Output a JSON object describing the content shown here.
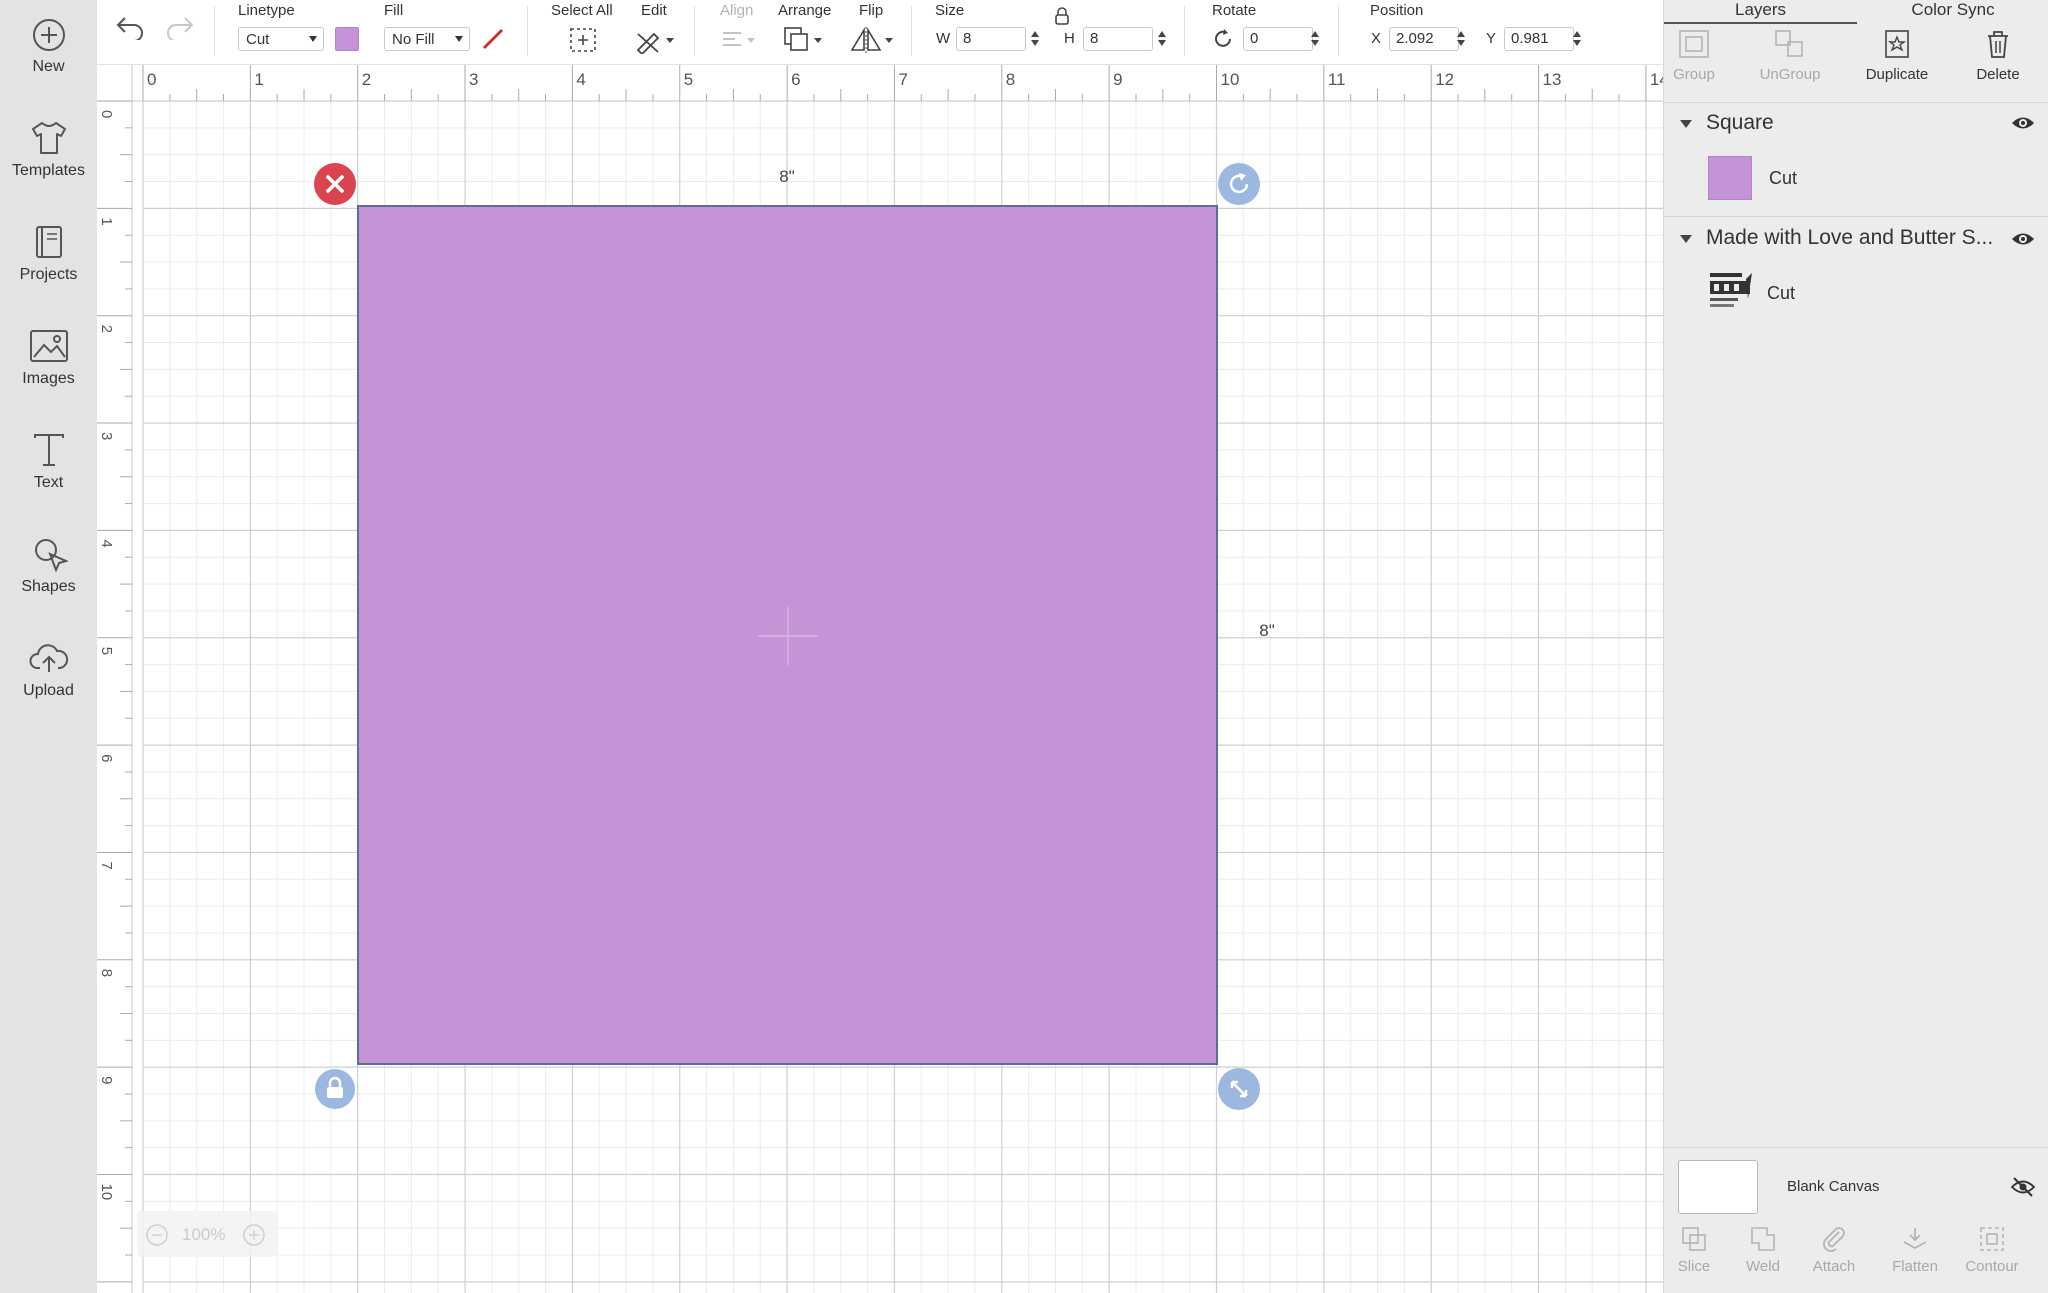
{
  "sidebar": {
    "items": [
      {
        "label": "New",
        "icon": "plus-circle-icon"
      },
      {
        "label": "Templates",
        "icon": "tshirt-icon"
      },
      {
        "label": "Projects",
        "icon": "book-icon"
      },
      {
        "label": "Images",
        "icon": "image-icon"
      },
      {
        "label": "Text",
        "icon": "text-t-icon"
      },
      {
        "label": "Shapes",
        "icon": "shapes-icon"
      },
      {
        "label": "Upload",
        "icon": "cloud-upload-icon"
      }
    ]
  },
  "toolbar": {
    "linetype_label": "Linetype",
    "linetype_value": "Cut",
    "fill_label": "Fill",
    "fill_value": "No Fill",
    "select_all_label": "Select All",
    "edit_label": "Edit",
    "align_label": "Align",
    "arrange_label": "Arrange",
    "flip_label": "Flip",
    "size_label": "Size",
    "w_label": "W",
    "w_value": "8",
    "h_label": "H",
    "h_value": "8",
    "rotate_label": "Rotate",
    "rotate_value": "0",
    "position_label": "Position",
    "x_label": "X",
    "x_value": "2.092",
    "y_label": "Y",
    "y_value": "0.981"
  },
  "canvas": {
    "ruler_top": [
      "0",
      "1",
      "2",
      "3",
      "4",
      "5",
      "6",
      "7",
      "8",
      "9",
      "10",
      "11",
      "12",
      "13",
      "14"
    ],
    "ruler_left": [
      "0",
      "1",
      "2",
      "3",
      "4",
      "5",
      "6",
      "7",
      "8",
      "9",
      "10"
    ],
    "width_dimension": "8\"",
    "height_dimension": "8\"",
    "zoom_value": "100%"
  },
  "right_panel": {
    "tabs": [
      "Layers",
      "Color Sync"
    ],
    "actions": [
      "Group",
      "UnGroup",
      "Duplicate",
      "Delete"
    ],
    "layers": [
      {
        "name": "Square",
        "child_label": "Cut"
      },
      {
        "name": "Made with Love and Butter S...",
        "child_label": "Cut"
      }
    ],
    "blank_canvas_label": "Blank Canvas",
    "bottom_actions": [
      "Slice",
      "Weld",
      "Attach",
      "Flatten",
      "Contour"
    ]
  },
  "colors": {
    "accent": "#c594d6",
    "shape_fill": "#c594d6",
    "delete_handle": "#d9464f",
    "handle_blue": "#9db8e0"
  }
}
